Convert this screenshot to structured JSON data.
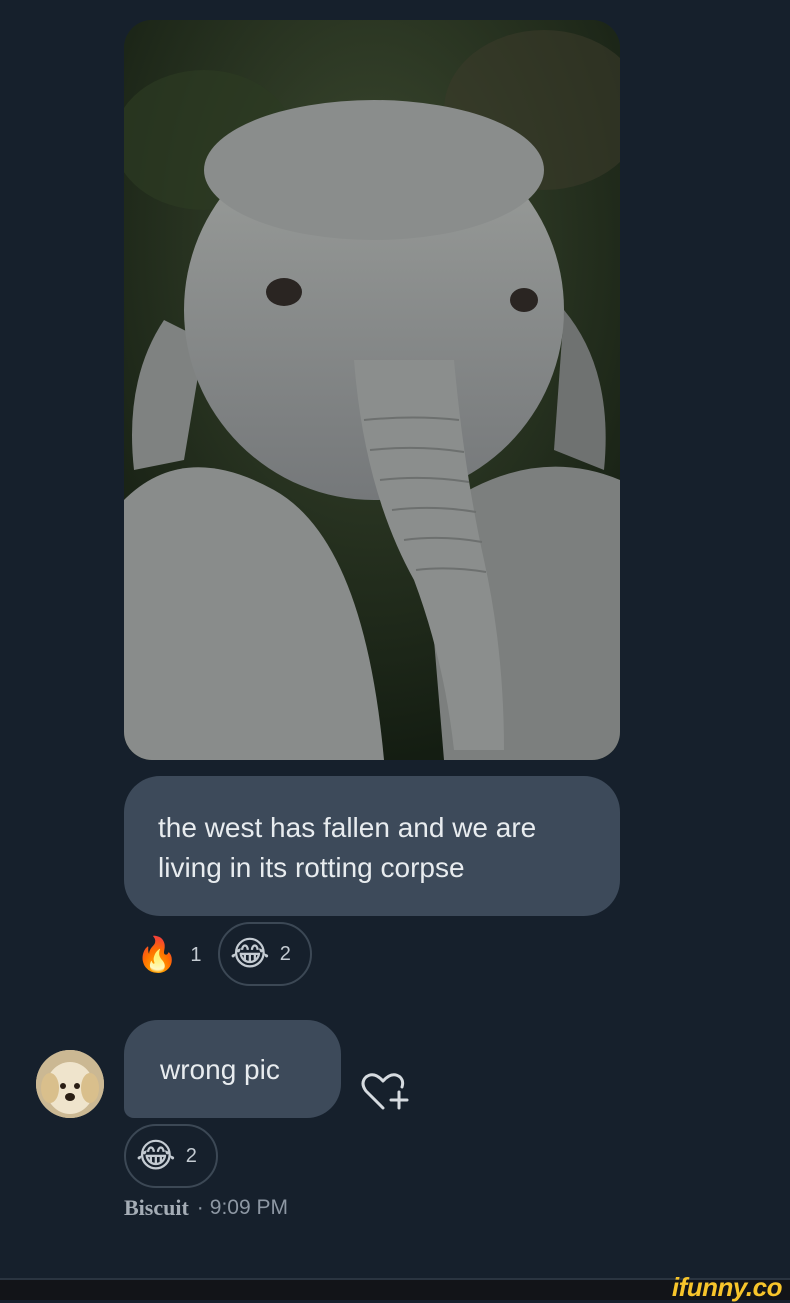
{
  "messages": [
    {
      "text": "the west has fallen and we are living in its rotting corpse",
      "reactions": [
        {
          "icon": "fire-emoji",
          "emoji": "🔥",
          "count": "1"
        },
        {
          "icon": "tears-of-joy-emoji",
          "emoji": "😂",
          "count": "2"
        }
      ]
    },
    {
      "text": "wrong pic",
      "reactions": [
        {
          "icon": "tears-of-joy-emoji",
          "emoji": "😂",
          "count": "2"
        }
      ]
    }
  ],
  "sender": {
    "name": "Biscuit",
    "separator": "·",
    "time": "9:09 PM",
    "avatar_icon": "golden-retriever-puppy-avatar"
  },
  "add_reaction_icon": "heart-plus-icon",
  "watermark": "ifunny.co",
  "colors": {
    "background": "#16202c",
    "bubble": "#3d4a5a",
    "text": "#e8ecef",
    "watermark": "#f7c52b"
  }
}
